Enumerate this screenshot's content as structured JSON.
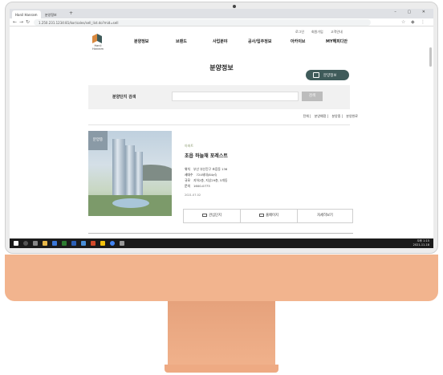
{
  "browser": {
    "tabs": [
      {
        "label": "Hanil Hanram"
      },
      {
        "label": "분양정보"
      }
    ],
    "url": "1.250.231.1234:81/kor/sales/sell_list.do?mid=sell",
    "new_tab_symbol": "+",
    "window_controls": "–  ▢  ✕"
  },
  "header": {
    "util_links": [
      "로그인",
      "회원가입",
      "고객안내"
    ],
    "logo_text": "Hanil Hanram",
    "nav": [
      "분양정보",
      "브랜드",
      "사업분야",
      "공사/입주정보",
      "아카이브",
      "MY해피디안"
    ]
  },
  "page": {
    "title": "분양정보",
    "pill_button": "분양정보"
  },
  "search": {
    "label": "분양단지 검색",
    "placeholder": "",
    "button": "검색"
  },
  "filters": [
    "전체",
    "분양예정",
    "분양중",
    "분양완료"
  ],
  "listing": {
    "badge": "분양중",
    "category": "아파트",
    "name": "초읍 하늘채 포레스트",
    "rows": [
      {
        "key": "위치",
        "value": "부산 부산진구 초읍동 136"
      },
      {
        "key": "세대수",
        "value": "724세대(84㎡)"
      },
      {
        "key": "규모",
        "value": "지하2층, 지상29층, 5개동"
      },
      {
        "key": "문의",
        "value": "1600-0773"
      }
    ],
    "date": "2021.07.02",
    "buttons": {
      "model_house": "관심단지",
      "homepage": "홈페이지",
      "details": "자세히보기"
    }
  },
  "taskbar": {
    "time": "오후 1:15",
    "date": "2021-11-18"
  },
  "colors": {
    "chin": "#f2b48e",
    "stand": "#eeaa83",
    "accent": "#3f5b5a",
    "badge": "#8a9aa6"
  }
}
